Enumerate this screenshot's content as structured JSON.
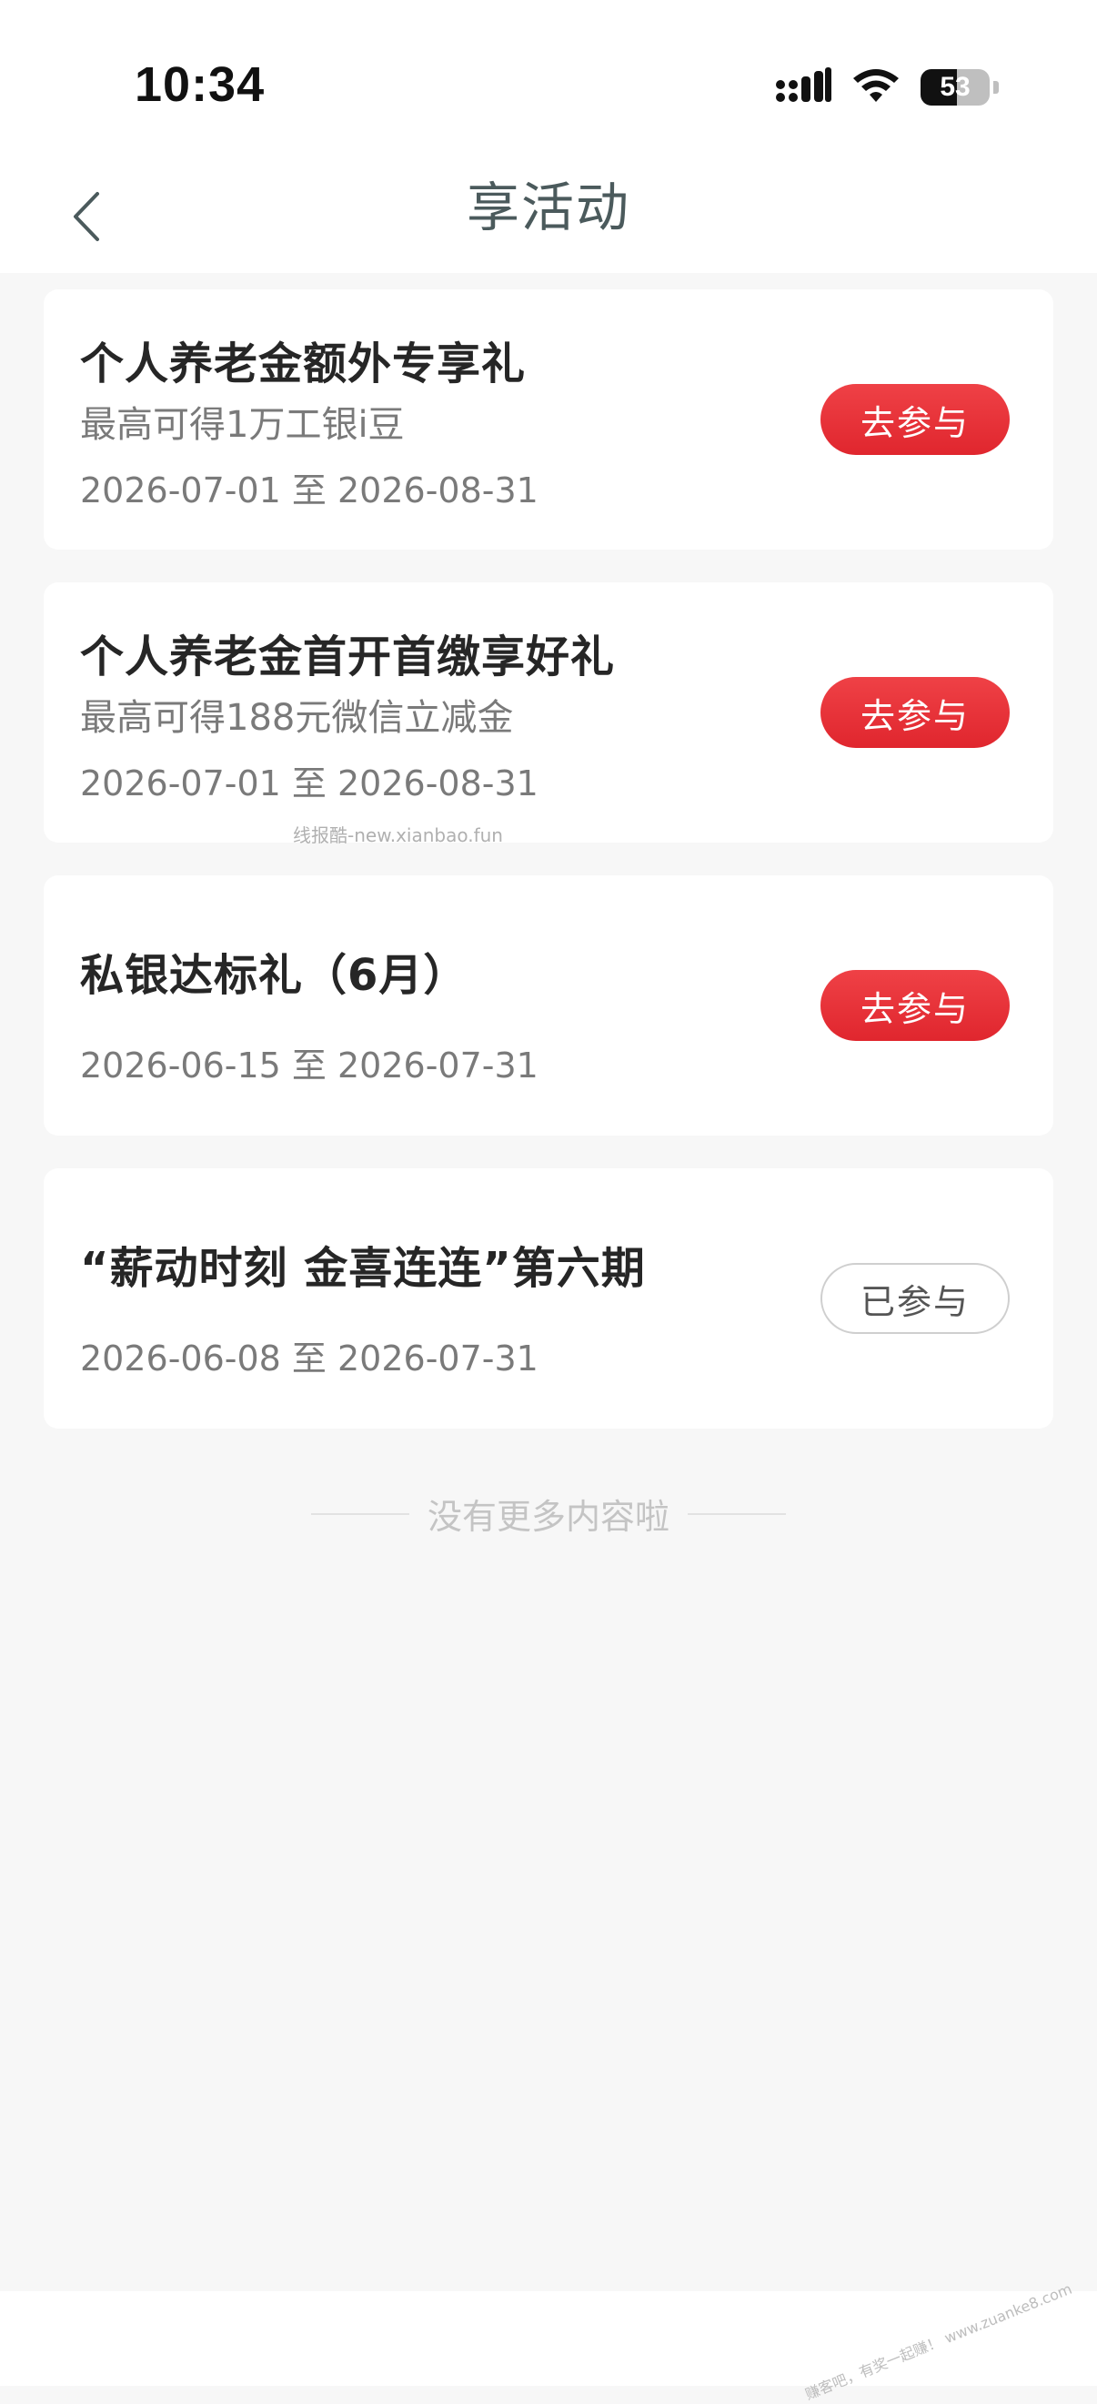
{
  "status_bar": {
    "time": "10:34",
    "battery": "53",
    "battery_level": 0.53,
    "icons": [
      "signal-icon",
      "wifi-icon",
      "battery-icon"
    ]
  },
  "nav": {
    "title": "享活动",
    "back_icon": "chevron-left-icon"
  },
  "activities": [
    {
      "title": "个人养老金额外专享礼",
      "subtitle": "最高可得1万工银i豆",
      "date": "2026-07-01 至 2026-08-31",
      "button": "去参与",
      "joined": false
    },
    {
      "title": "个人养老金首开首缴享好礼",
      "subtitle": "最高可得188元微信立减金",
      "date": "2026-07-01 至 2026-08-31",
      "button": "去参与",
      "joined": false
    },
    {
      "title": "私银达标礼（6月）",
      "date": "2026-06-15 至 2026-07-31",
      "button": "去参与",
      "joined": false
    },
    {
      "title": "“薪动时刻 金喜连连”第六期",
      "date": "2026-06-08 至 2026-07-31",
      "button": "已参与",
      "joined": true
    }
  ],
  "end_hint": "没有更多内容啦",
  "watermark": "线报酷-new.xianbao.fun",
  "corner_watermark": "赚客吧，有奖一起赚！ www.zuanke8.com",
  "colors": {
    "accent_red": "#e0262e",
    "title_gray": "#4b5a5c",
    "background": "#f7f7f7"
  }
}
